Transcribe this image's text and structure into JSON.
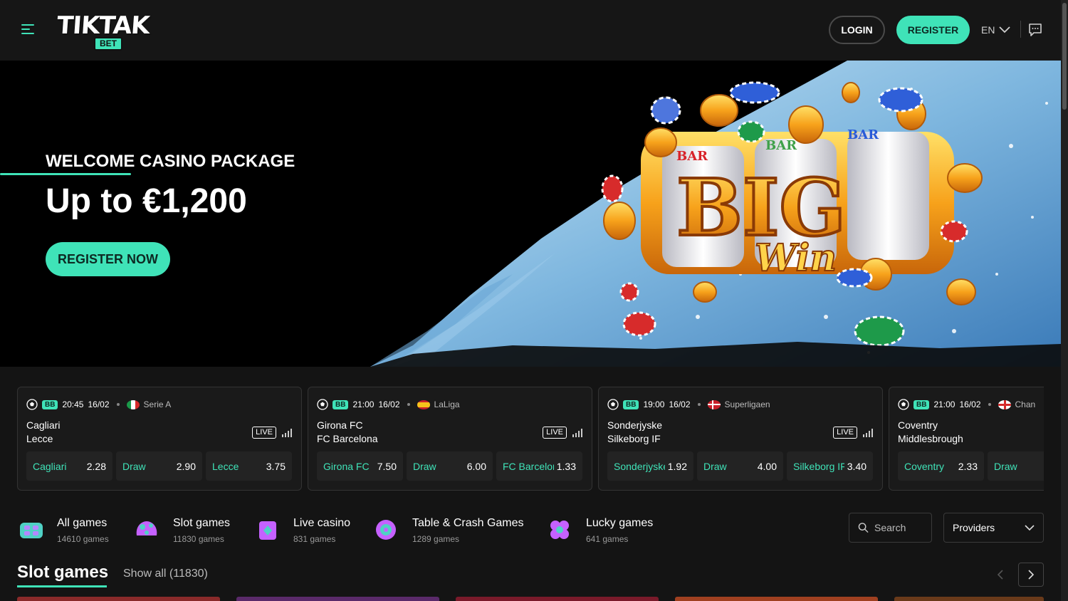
{
  "header": {
    "logo_text": "TIKTAK",
    "logo_sub": "BET",
    "login_label": "LOGIN",
    "register_label": "REGISTER",
    "language": "EN",
    "accent_color": "#3fe3b8"
  },
  "hero": {
    "kicker": "WELCOME CASINO PACKAGE",
    "title": "Up to €1,200",
    "cta_label": "REGISTER NOW",
    "art_text": "BIG",
    "art_sub": "Win",
    "reel_labels": [
      "BAR",
      "BAR",
      "BAR"
    ]
  },
  "matches": [
    {
      "badge": "BB",
      "time": "20:45",
      "date": "16/02",
      "league": "Serie A",
      "home": "Cagliari",
      "away": "Lecce",
      "live": "LIVE",
      "odds": [
        {
          "label": "Cagliari",
          "value": "2.28"
        },
        {
          "label": "Draw",
          "value": "2.90"
        },
        {
          "label": "Lecce",
          "value": "3.75"
        }
      ]
    },
    {
      "badge": "BB",
      "time": "21:00",
      "date": "16/02",
      "league": "LaLiga",
      "home": "Girona FC",
      "away": "FC Barcelona",
      "live": "LIVE",
      "odds": [
        {
          "label": "Girona FC",
          "value": "7.50"
        },
        {
          "label": "Draw",
          "value": "6.00"
        },
        {
          "label": "FC Barcelona",
          "value": "1.33"
        }
      ]
    },
    {
      "badge": "BB",
      "time": "19:00",
      "date": "16/02",
      "league": "Superligaen",
      "home": "Sonderjyske",
      "away": "Silkeborg IF",
      "live": "LIVE",
      "odds": [
        {
          "label": "Sonderjyske",
          "value": "1.92"
        },
        {
          "label": "Draw",
          "value": "4.00"
        },
        {
          "label": "Silkeborg IF",
          "value": "3.40"
        }
      ]
    },
    {
      "badge": "BB",
      "time": "21:00",
      "date": "16/02",
      "league": "Chan",
      "home": "Coventry",
      "away": "Middlesbrough",
      "live": "",
      "odds": [
        {
          "label": "Coventry",
          "value": "2.33"
        },
        {
          "label": "Draw",
          "value": ""
        }
      ]
    }
  ],
  "categories": [
    {
      "name": "All games",
      "count": "14610 games",
      "icon": "gamepad-icon"
    },
    {
      "name": "Slot games",
      "count": "11830 games",
      "icon": "slot-machine-icon"
    },
    {
      "name": "Live casino",
      "count": "831 games",
      "icon": "live-casino-icon"
    },
    {
      "name": "Table & Crash Games",
      "count": "1289 games",
      "icon": "roulette-icon"
    },
    {
      "name": "Lucky games",
      "count": "641 games",
      "icon": "lucky-clover-icon"
    }
  ],
  "search": {
    "placeholder": "Search"
  },
  "providers": {
    "label": "Providers"
  },
  "section": {
    "title": "Slot games",
    "show_all": "Show all (11830)"
  }
}
